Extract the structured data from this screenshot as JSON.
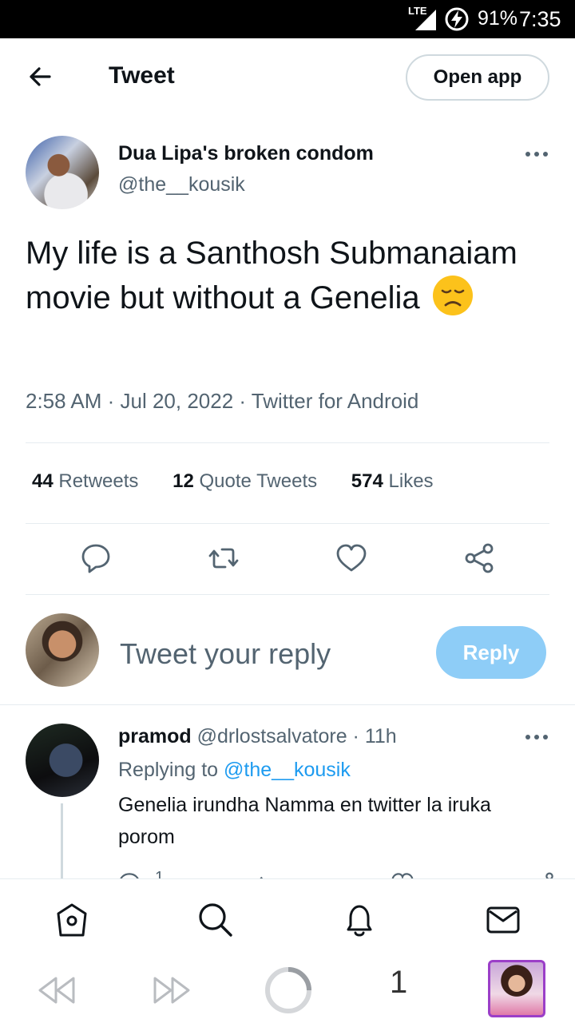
{
  "status_bar": {
    "network": "LTE",
    "battery": "91%",
    "time": "7:35"
  },
  "header": {
    "title": "Tweet",
    "open_app_label": "Open app"
  },
  "tweet": {
    "author_name": "Dua Lipa's broken condom",
    "author_handle": "@the__kousik",
    "text": "My life is a Santhosh Submanaiam movie but without a Genelia",
    "emoji": "disappointed-face",
    "meta": "2:58 AM · Jul 20, 2022 · Twitter for Android",
    "stats": [
      {
        "count": "44",
        "label": "Retweets"
      },
      {
        "count": "12",
        "label": "Quote Tweets"
      },
      {
        "count": "574",
        "label": "Likes"
      }
    ]
  },
  "composer": {
    "placeholder": "Tweet your reply",
    "reply_label": "Reply"
  },
  "reply": {
    "name": "pramod",
    "handle": "@drlostsalvatore",
    "time": "· 11h",
    "replying_prefix": "Replying to",
    "replying_to": "@the__kousik",
    "text": "Genelia irundha Namma en twitter la iruka porom",
    "reply_count": "1"
  },
  "browser": {
    "tab_count": "1"
  },
  "colors": {
    "accent": "#1d9bf0",
    "reply_button": "#8ecdf7",
    "muted_text": "#536471"
  }
}
